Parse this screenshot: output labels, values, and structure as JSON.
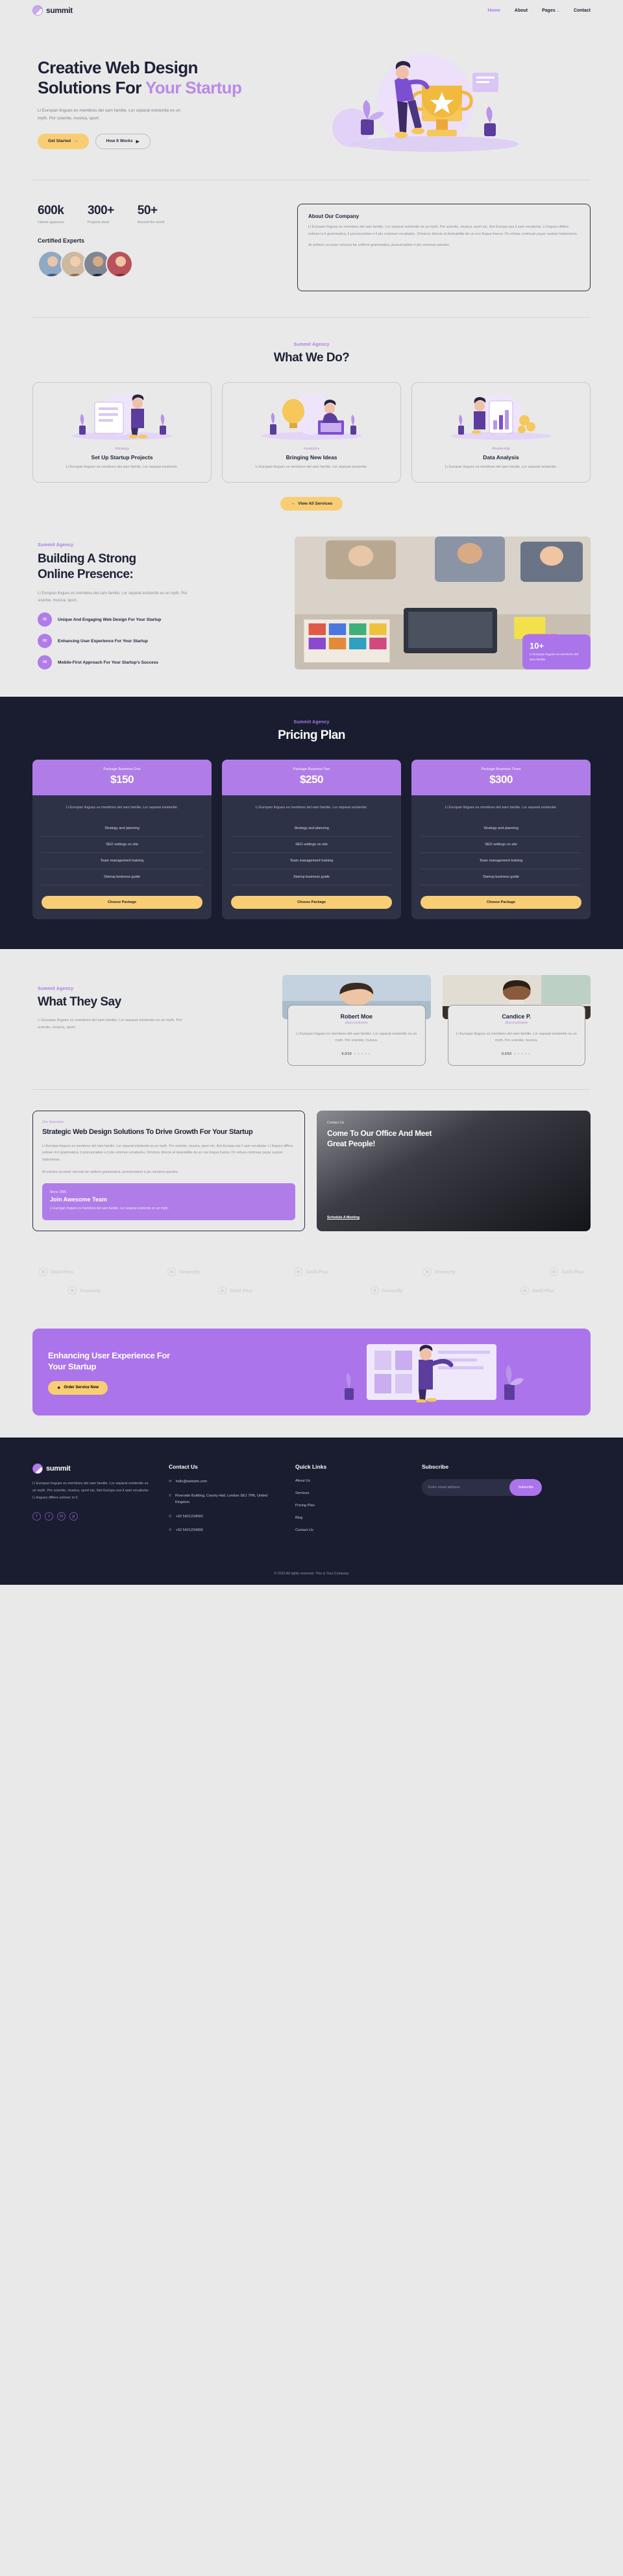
{
  "brand": {
    "name": "summit"
  },
  "nav": {
    "items": [
      {
        "label": "Home",
        "active": true
      },
      {
        "label": "About",
        "active": false
      },
      {
        "label": "Pages",
        "active": false,
        "caret": "⌄"
      },
      {
        "label": "Contact",
        "active": false
      }
    ]
  },
  "hero": {
    "title_1": "Creative Web Design",
    "title_2": "Solutions For ",
    "title_accent": "Your Startup",
    "description": "Li Europan lingues es membres del sam familie. Lor separat existentie es un myth. Por scientie, musica, sport.",
    "primary_button": "Get Started",
    "primary_arrow": "→",
    "secondary_button": "How It Works",
    "secondary_icon": "▶"
  },
  "stats": {
    "items": [
      {
        "value": "600k",
        "label": "Clients approves"
      },
      {
        "value": "300+",
        "label": "Projects done"
      },
      {
        "value": "50+",
        "label": "Around the world"
      }
    ],
    "certified_title": "Certified Experts"
  },
  "about": {
    "title": "About Our Company",
    "paragraph_1": "Li Europan lingues es membres del sam familie. Lor separat existentie es un myth. Por scientie, musica, sport etc, litot Europa usa li sam vocabular. Li lingues differe solmen in li grammatica, li pronunciation e li plu commun vocabules. Omnicos directe al desirabilite de un nov lingua franca: On refusa continuar payar custosi traductores.",
    "paragraph_2": "At solmen va esser necessi far uniform grammatica, pronunciation e plu sommun paroles."
  },
  "services": {
    "eyebrow": "Summit Agency",
    "title": "What We Do?",
    "cards": [
      {
        "tag": "#strategy",
        "title": "Set Up Startup Projects",
        "desc": "Li Europan lingues es membres del sam familie. Lor separat existentie."
      },
      {
        "tag": "#analytics",
        "title": "Bringing New Ideas",
        "desc": "Li Europan lingues es membres del sam familie. Lor separat existentie."
      },
      {
        "tag": "#leadership",
        "title": "Data Analysis",
        "desc": "Li Europan lingues es membres del sam familie. Lor separat existentie."
      }
    ],
    "view_all": "View All Services",
    "view_all_arrow": "→"
  },
  "presence": {
    "eyebrow": "Summit Agency",
    "title_1": "Building A Strong",
    "title_2": "Online Presence:",
    "description": "Li Europan lingues es membres del sam familie. Lor separat existentie es un myth. Por scientie, musica, sport.",
    "features": [
      {
        "num": "01",
        "text": "Unique And Engaging Web Design For Your Startup"
      },
      {
        "num": "02",
        "text": "Enhancing User Experience For Your Startup"
      },
      {
        "num": "03",
        "text": "Mobile-First Approach For Your Startup's Success"
      }
    ],
    "badge_number": "10+",
    "badge_text": "Li Europan lingues es membres del sam familie."
  },
  "pricing": {
    "eyebrow": "Summit Agency",
    "title": "Pricing Plan",
    "plans": [
      {
        "name": "Package Business One",
        "price": "$150",
        "desc": "Li Europan lingues es membres del sam familie. Lor separat existentie.",
        "features": [
          "Strategy and planning",
          "SEO settings on site",
          "Team management training",
          "Startup business guide"
        ],
        "button": "Choose Package"
      },
      {
        "name": "Package Business Two",
        "price": "$250",
        "desc": "Li Europan lingues es membres del sam familie. Lor separat existentie.",
        "features": [
          "Strategy and planning",
          "SEO settings on site",
          "Team management training",
          "Startup business guide"
        ],
        "button": "Choose Package"
      },
      {
        "name": "Package Business Three",
        "price": "$300",
        "desc": "Li Europan lingues es membres del sam familie. Lor separat existentie.",
        "features": [
          "Strategy and planning",
          "SEO settings on site",
          "Team management training",
          "Startup business guide"
        ],
        "button": "Choose Package"
      }
    ]
  },
  "testimonials": {
    "eyebrow": "Summit Agency",
    "title": "What They Say",
    "description": "Li Europan lingues es membres del sam familie. Lor separat existentie es un myth. Por scientie, musica, sport.",
    "cards": [
      {
        "name": "Robert Moe",
        "handle": "@accountname",
        "quote": "Li Europan lingues es membres del sam familie. Lor separat existentie es un myth. Por scientie, musica.",
        "rating": "9.2/10",
        "stars": "★★★★★"
      },
      {
        "name": "Candice P.",
        "handle": "@accountname",
        "quote": "Li Europan lingues es membres del sam familie. Lor separat existentie es un myth. Por scientie, musica.",
        "rating": "9.2/10",
        "stars": "★★★★★"
      }
    ]
  },
  "cta": {
    "left": {
      "label": "Our Interview",
      "title": "Strategic Web Design Solutions To Drive Growth For Your Startup",
      "body": "Li Europan lingues es membres del sam familie. Lor separat existentie es un myth. Por scientie, musica, sport etc, litot Europa usa li sam vocabular. Li lingues differe solmen in li grammatica, li pronunciation e li plu commun vocabules. Omnicos directe al desirabilite de un nov lingua franca: On refusa continuar payar custosi traductores.",
      "body_2": "At solmen va esser necessi far uniform grammatica, pronunciation e plu sommun paroles.",
      "join_label": "Since 1995",
      "join_title": "Join Awesome Team",
      "join_text": "Li Europan lingues es membres del sam familie. Lor separat existentie es un myth."
    },
    "right": {
      "label": "Contact Us",
      "title_1": "Come To Our Office And Meet",
      "title_2": "Great People!",
      "link": "Schedule A Meeting"
    }
  },
  "logos": {
    "row1": [
      "Gold Plus",
      "Growcify",
      "Gold Plus",
      "Growcify",
      "Gold Plus"
    ],
    "row2": [
      "Growcify",
      "Gold Plus",
      "Growcify",
      "Gold Plus"
    ]
  },
  "banner": {
    "title_1": "Enhancing User Experience For",
    "title_2": "Your Startup",
    "button": "Order Service Now",
    "button_icon": "★"
  },
  "footer": {
    "brand": "summit",
    "about": "Li Europan lingues es membres del sam familie. Lor separat existentie es un myth. Por scientie, musica, sport etc, litot Europa usa li sam vocabular. Li lingues differe solmen in li.",
    "socials": [
      "f",
      "t",
      "in",
      "p"
    ],
    "contact": {
      "title": "Contact Us",
      "email": "hello@website.com",
      "email_icon": "✉",
      "address": "Riverside Building, County Hall, London SE1 7PB, United Kingdom",
      "address_icon": "⚲",
      "phone_1": "+02 5421234560",
      "phone_2": "+02 5421234999",
      "phone_icon": "✆"
    },
    "quick_links": {
      "title": "Quick Links",
      "items": [
        "About Us",
        "Services",
        "Pricing Plan",
        "Blog",
        "Contact Us"
      ]
    },
    "subscribe": {
      "title": "Subscribe",
      "placeholder": "Enter email address",
      "value": "",
      "button": "Subscribe"
    },
    "copyright": "© 2023 All rights reserved. This is Your Company"
  },
  "colors": {
    "accent_purple": "#b07de8",
    "accent_yellow": "#f9cd73",
    "dark": "#191d2f",
    "page_bg": "#e9e9e9"
  }
}
